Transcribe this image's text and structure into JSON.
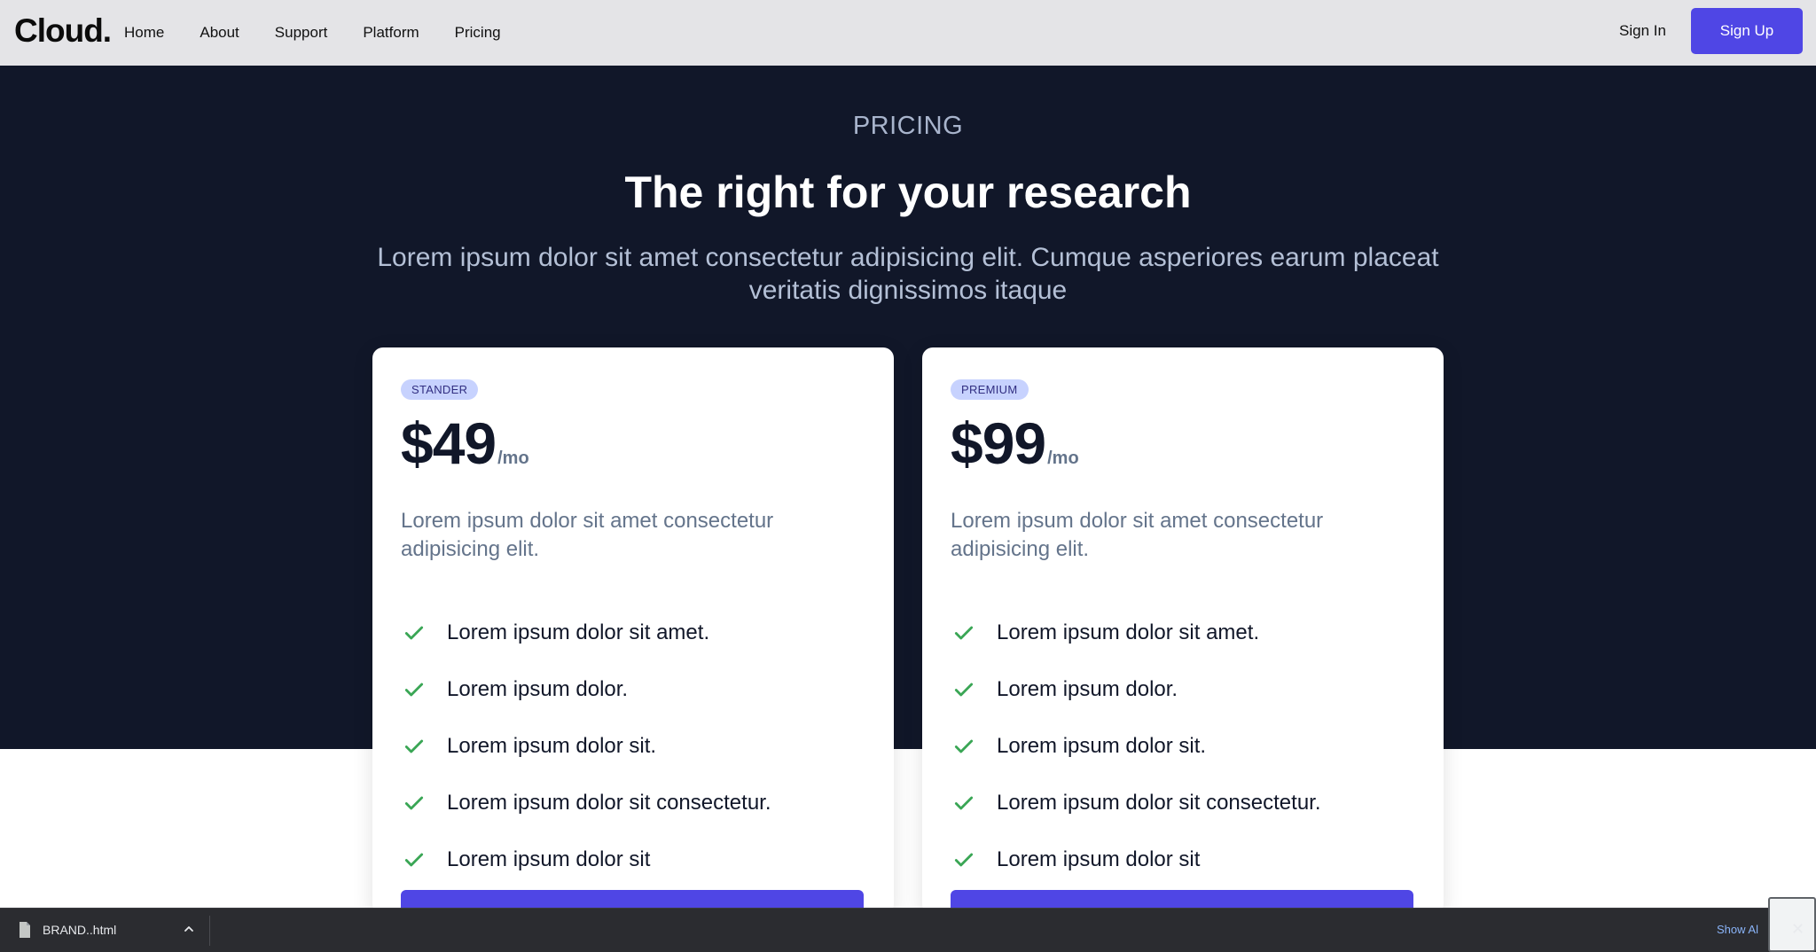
{
  "navbar": {
    "logo": "Cloud.",
    "links": [
      "Home",
      "About",
      "Support",
      "Platform",
      "Pricing"
    ],
    "sign_in": "Sign In",
    "sign_up": "Sign Up"
  },
  "hero": {
    "eyebrow": "PRICING",
    "headline": "The right for your research",
    "subhead": "Lorem ipsum dolor sit amet consectetur adipisicing elit. Cumque asperiores earum placeat veritatis dignissimos itaque"
  },
  "plans": [
    {
      "badge": "STANDER",
      "price": "$49",
      "period": "/mo",
      "description": "Lorem ipsum dolor sit amet consectetur adipisicing elit.",
      "features": [
        "Lorem ipsum dolor sit amet.",
        "Lorem ipsum dolor.",
        "Lorem ipsum dolor sit.",
        "Lorem ipsum dolor sit consectetur.",
        "Lorem ipsum dolor sit"
      ]
    },
    {
      "badge": "PREMIUM",
      "price": "$99",
      "period": "/mo",
      "description": "Lorem ipsum dolor sit amet consectetur adipisicing elit.",
      "features": [
        "Lorem ipsum dolor sit amet.",
        "Lorem ipsum dolor.",
        "Lorem ipsum dolor sit.",
        "Lorem ipsum dolor sit consectetur.",
        "Lorem ipsum dolor sit"
      ]
    }
  ],
  "download_bar": {
    "file_name": "BRAND..html",
    "show_all": "Show Al",
    "close": "✕"
  },
  "colors": {
    "accent": "#4f46e5",
    "hero_bg": "#111729",
    "check": "#3aa655",
    "badge_bg": "#c7d2fe"
  },
  "icons": {
    "feature": "check-icon",
    "file": "file-icon",
    "chevron": "chevron-up-icon"
  }
}
